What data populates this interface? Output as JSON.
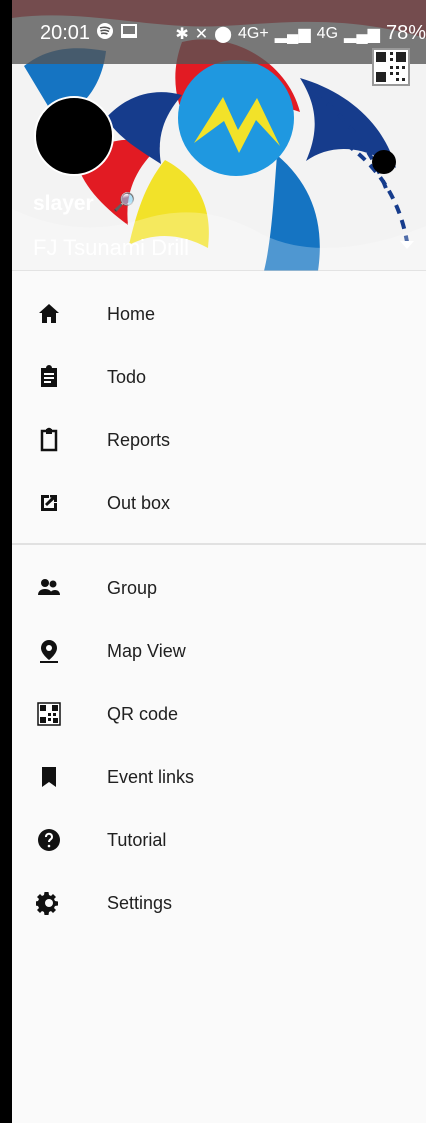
{
  "status_bar": {
    "time": "20:01",
    "battery": "78%",
    "icons": [
      "spotify-icon",
      "cast-icon",
      "bluetooth-icon",
      "mute-icon",
      "location-icon",
      "network-icon",
      "signal-icon"
    ],
    "signal_labels": [
      "4G+",
      "4G"
    ]
  },
  "header": {
    "username": "slayer",
    "event_name": "FJ Tsunami Drill",
    "badge_icon": "magnifier-badge-icon",
    "accent_colors": [
      "#e21b23",
      "#1574c2",
      "#f2e229",
      "#163c8c"
    ]
  },
  "menu": {
    "primary_items": [
      {
        "label": "Home",
        "icon": "home-icon"
      },
      {
        "label": "Todo",
        "icon": "clipboard-filled-icon"
      },
      {
        "label": "Reports",
        "icon": "clipboard-outline-icon"
      },
      {
        "label": "Out box",
        "icon": "open-in-new-icon"
      }
    ],
    "secondary_items": [
      {
        "label": "Group",
        "icon": "group-icon"
      },
      {
        "label": "Map View",
        "icon": "map-pin-icon"
      },
      {
        "label": "QR code",
        "icon": "qr-code-icon"
      },
      {
        "label": "Event links",
        "icon": "bookmark-icon"
      },
      {
        "label": "Tutorial",
        "icon": "help-icon"
      },
      {
        "label": "Settings",
        "icon": "settings-icon"
      }
    ]
  }
}
